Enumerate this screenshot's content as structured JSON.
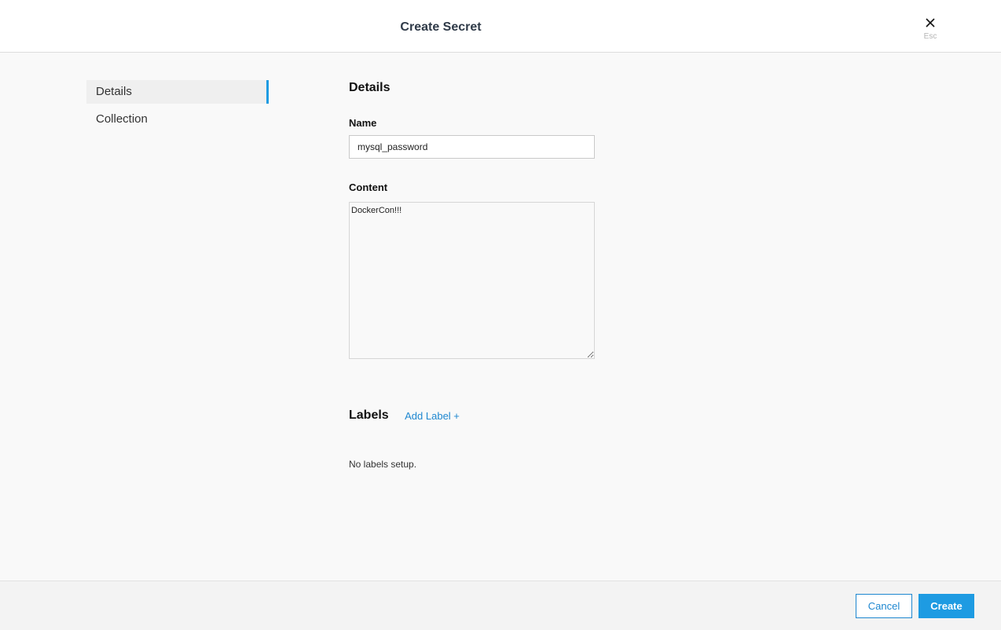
{
  "header": {
    "title": "Create Secret",
    "close_hint": "Esc",
    "close_icon": "close-icon"
  },
  "sidebar": {
    "items": [
      {
        "label": "Details",
        "active": true
      },
      {
        "label": "Collection",
        "active": false
      }
    ]
  },
  "details": {
    "section_title": "Details",
    "name_label": "Name",
    "name_value": "mysql_password",
    "content_label": "Content",
    "content_value": "DockerCon!!!"
  },
  "labels": {
    "section_title": "Labels",
    "add_link": "Add Label +",
    "empty_text": "No labels setup."
  },
  "footer": {
    "cancel_label": "Cancel",
    "create_label": "Create"
  },
  "colors": {
    "accent": "#1e9be2",
    "link": "#1e87d0",
    "title": "#2f3a48"
  }
}
